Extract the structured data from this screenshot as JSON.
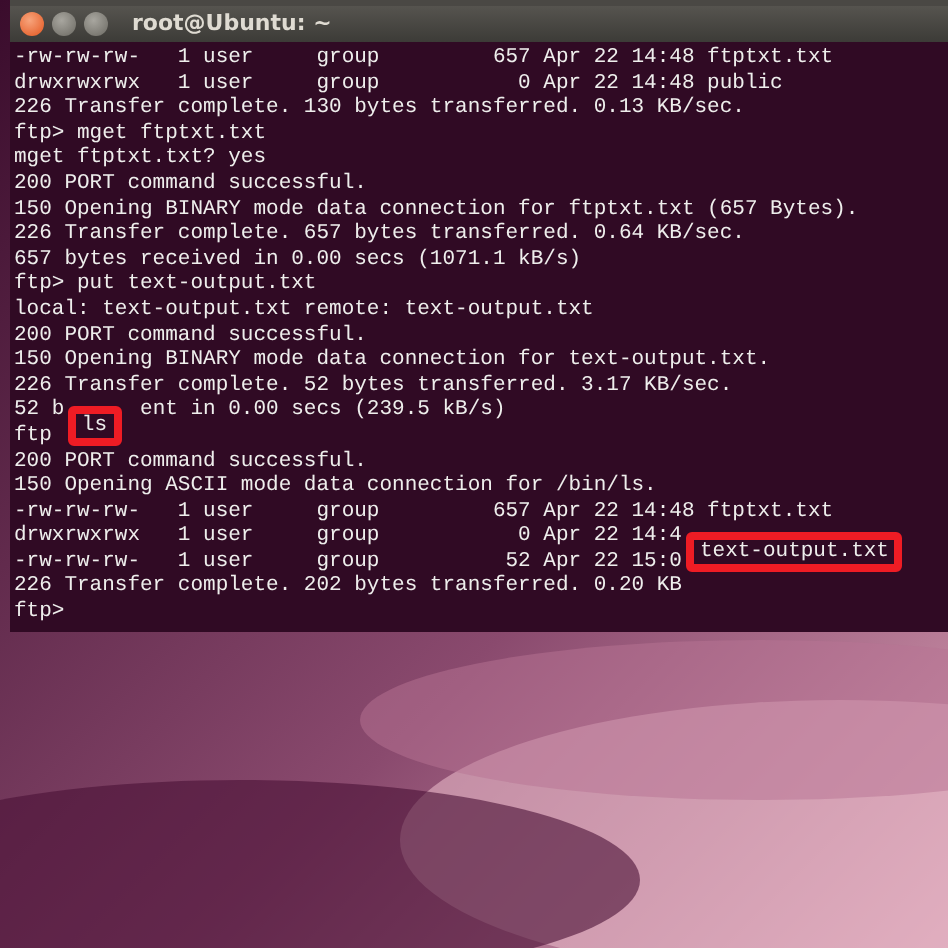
{
  "window": {
    "title": "root@Ubuntu: ~",
    "buttons": [
      {
        "kind": "close"
      },
      {
        "kind": "minimize"
      },
      {
        "kind": "maximize"
      }
    ]
  },
  "terminal": {
    "lines": [
      [
        {
          "kind": "text",
          "text": "-rw-rw-rw-   1 user     group         657 Apr 22 14:48 ftptxt.txt"
        }
      ],
      [
        {
          "kind": "text",
          "text": "drwxrwxrwx   1 user     group           0 Apr 22 14:48 public"
        }
      ],
      [
        {
          "kind": "text",
          "text": "226 Transfer complete. 130 bytes transferred. 0.13 KB/sec."
        }
      ],
      [
        {
          "kind": "text",
          "text": "ftp> mget ftptxt.txt"
        }
      ],
      [
        {
          "kind": "text",
          "text": "mget ftptxt.txt? yes"
        }
      ],
      [
        {
          "kind": "text",
          "text": "200 PORT command successful."
        }
      ],
      [
        {
          "kind": "text",
          "text": "150 Opening BINARY mode data connection for ftptxt.txt (657 Bytes)."
        }
      ],
      [
        {
          "kind": "text",
          "text": "226 Transfer complete. 657 bytes transferred. 0.64 KB/sec."
        }
      ],
      [
        {
          "kind": "text",
          "text": "657 bytes received in 0.00 secs (1071.1 kB/s)"
        }
      ],
      [
        {
          "kind": "text",
          "text": "ftp> put text-output.txt"
        }
      ],
      [
        {
          "kind": "text",
          "text": "local: text-output.txt remote: text-output.txt"
        }
      ],
      [
        {
          "kind": "text",
          "text": "200 PORT command successful."
        }
      ],
      [
        {
          "kind": "text",
          "text": "150 Opening BINARY mode data connection for text-output.txt."
        }
      ],
      [
        {
          "kind": "text",
          "text": "226 Transfer complete. 52 bytes transferred. 3.17 KB/sec."
        }
      ],
      [
        {
          "kind": "text",
          "text": "52 b"
        },
        {
          "kind": "resume",
          "text": "ent in 0.00 secs (239.5 kB/s)"
        }
      ],
      [
        {
          "kind": "text",
          "text": "ftp"
        },
        {
          "kind": "boxed",
          "text": "ls"
        }
      ],
      [
        {
          "kind": "text",
          "text": "200 PORT command successful."
        }
      ],
      [
        {
          "kind": "text",
          "text": "150 Opening ASCII mode data connection for /bin/ls."
        }
      ],
      [
        {
          "kind": "text",
          "text": "-rw-rw-rw-   1 user     group         657 Apr 22 14:48 ftptxt.txt"
        }
      ],
      [
        {
          "kind": "text",
          "text": "drwxrwxrwx   1 user     group           0 Apr 22 14:4"
        }
      ],
      [
        {
          "kind": "text",
          "text": "-rw-rw-rw-   1 user     group          52 Apr 22 15:0"
        },
        {
          "kind": "boxed",
          "text": "text-output.txt"
        }
      ],
      [
        {
          "kind": "text",
          "text": "226 Transfer complete. 202 bytes transferred. 0.20 KB"
        }
      ],
      [
        {
          "kind": "text",
          "text": "ftp>"
        }
      ]
    ]
  }
}
